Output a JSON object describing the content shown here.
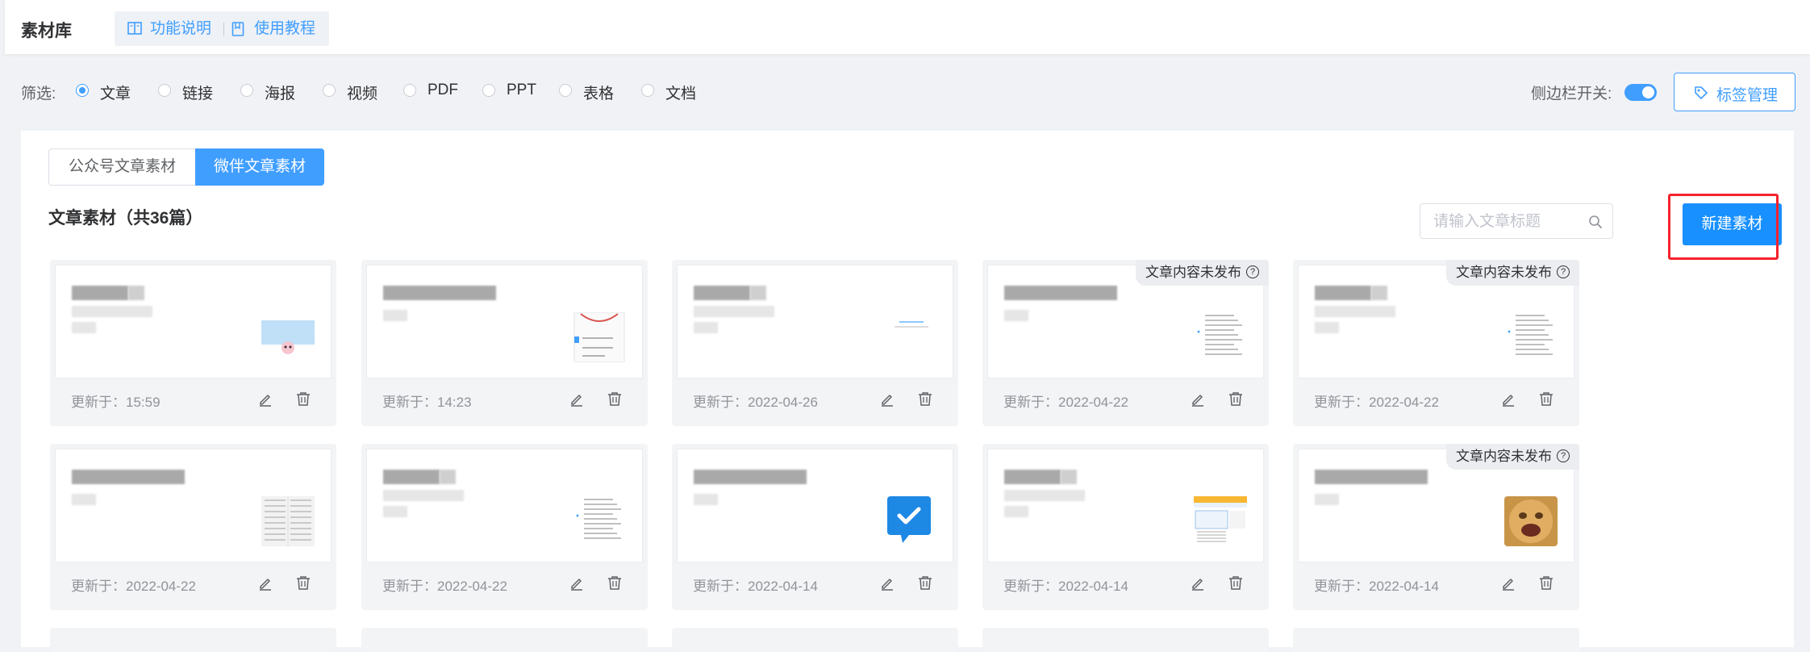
{
  "header": {
    "title": "素材库",
    "help_links": [
      {
        "label": "功能说明",
        "icon": "book-icon"
      },
      {
        "label": "使用教程",
        "icon": "document-icon"
      }
    ]
  },
  "filter": {
    "label": "筛选:",
    "options": [
      "文章",
      "链接",
      "海报",
      "视频",
      "PDF",
      "PPT",
      "表格",
      "文档"
    ],
    "selected": "文章"
  },
  "sidebar_toggle": {
    "label": "侧边栏开关:",
    "on": true
  },
  "tag_manage_button": {
    "label": "标签管理",
    "icon": "tag-icon"
  },
  "source_tabs": {
    "items": [
      "公众号文章素材",
      "微伴文章素材"
    ],
    "active": "微伴文章素材"
  },
  "section": {
    "title": "文章素材（共36篇）"
  },
  "search": {
    "placeholder": "请输入文章标题",
    "value": ""
  },
  "new_button": {
    "label": "新建素材"
  },
  "unpublished_label": "文章内容未发布",
  "cards": [
    {
      "updated": "更新于：15:59",
      "unpublished": false,
      "thumbnail": "pink-sticker"
    },
    {
      "updated": "更新于：14:23",
      "unpublished": false,
      "thumbnail": "phone-screenshot"
    },
    {
      "updated": "更新于：2022-04-26",
      "unpublished": false,
      "thumbnail": "small-banner"
    },
    {
      "updated": "更新于：2022-04-22",
      "unpublished": true,
      "thumbnail": "text-list"
    },
    {
      "updated": "更新于：2022-04-22",
      "unpublished": true,
      "thumbnail": "text-list"
    },
    {
      "updated": "更新于：2022-04-22",
      "unpublished": false,
      "thumbnail": "document-pages"
    },
    {
      "updated": "更新于：2022-04-22",
      "unpublished": false,
      "thumbnail": "text-list"
    },
    {
      "updated": "更新于：2022-04-14",
      "unpublished": false,
      "thumbnail": "checkmark-chat"
    },
    {
      "updated": "更新于：2022-04-14",
      "unpublished": false,
      "thumbnail": "web-screenshot"
    },
    {
      "updated": "更新于：2022-04-14",
      "unpublished": true,
      "thumbnail": "face-photo"
    }
  ],
  "colors": {
    "primary": "#409eff",
    "button": "#1890ff",
    "highlight": "#f5222d",
    "background": "#f0f2f5"
  }
}
